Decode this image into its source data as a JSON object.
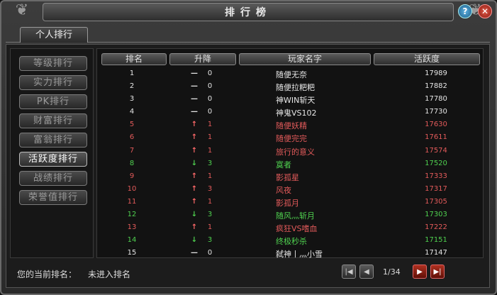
{
  "window": {
    "title": "排行榜"
  },
  "tabs": [
    {
      "label": "个人排行"
    }
  ],
  "sidebar": {
    "items": [
      {
        "label": "等级排行",
        "active": false
      },
      {
        "label": "实力排行",
        "active": false
      },
      {
        "label": "PK排行",
        "active": false
      },
      {
        "label": "财富排行",
        "active": false
      },
      {
        "label": "富翁排行",
        "active": false
      },
      {
        "label": "活跃度排行",
        "active": true
      },
      {
        "label": "战绩排行",
        "active": false
      },
      {
        "label": "荣誉值排行",
        "active": false
      }
    ]
  },
  "table": {
    "headers": {
      "rank": "排名",
      "change": "升降",
      "player": "玩家名字",
      "score": "活跃度"
    },
    "rows": [
      {
        "rank": "1",
        "arrow": "—",
        "delta": "0",
        "name": "随便无奈",
        "score": "17989",
        "color": "white"
      },
      {
        "rank": "2",
        "arrow": "—",
        "delta": "0",
        "name": "随便拉粑粑",
        "score": "17882",
        "color": "white"
      },
      {
        "rank": "3",
        "arrow": "—",
        "delta": "0",
        "name": "神WIN斩天",
        "score": "17780",
        "color": "white"
      },
      {
        "rank": "4",
        "arrow": "—",
        "delta": "0",
        "name": "神鬼VS102",
        "score": "17730",
        "color": "white"
      },
      {
        "rank": "5",
        "arrow": "↑",
        "delta": "1",
        "name": "随便妖精",
        "score": "17630",
        "color": "red"
      },
      {
        "rank": "6",
        "arrow": "↑",
        "delta": "1",
        "name": "随便完完",
        "score": "17611",
        "color": "red"
      },
      {
        "rank": "7",
        "arrow": "↑",
        "delta": "1",
        "name": "旅行的意义",
        "score": "17574",
        "color": "red"
      },
      {
        "rank": "8",
        "arrow": "↓",
        "delta": "3",
        "name": "寞者",
        "score": "17520",
        "color": "green"
      },
      {
        "rank": "9",
        "arrow": "↑",
        "delta": "1",
        "name": "影孤星",
        "score": "17333",
        "color": "red"
      },
      {
        "rank": "10",
        "arrow": "↑",
        "delta": "3",
        "name": "风夜",
        "score": "17317",
        "color": "red"
      },
      {
        "rank": "11",
        "arrow": "↑",
        "delta": "1",
        "name": "影孤月",
        "score": "17305",
        "color": "red"
      },
      {
        "rank": "12",
        "arrow": "↓",
        "delta": "3",
        "name": "随风灬斩月",
        "score": "17303",
        "color": "green"
      },
      {
        "rank": "13",
        "arrow": "↑",
        "delta": "1",
        "name": "疯狂VS嗜血",
        "score": "17222",
        "color": "red"
      },
      {
        "rank": "14",
        "arrow": "↓",
        "delta": "3",
        "name": "终极秒杀",
        "score": "17151",
        "color": "green"
      },
      {
        "rank": "15",
        "arrow": "—",
        "delta": "0",
        "name": "弑神丨灬小雪",
        "score": "17147",
        "color": "white"
      }
    ]
  },
  "footer": {
    "current_rank_label": "您的当前排名：",
    "current_rank_value": "未进入排名",
    "page": "1/34"
  },
  "icons": {
    "help": "question-icon",
    "close": "close-icon",
    "first": "first-page-icon",
    "prev": "prev-page-icon",
    "next": "next-page-icon",
    "last": "last-page-icon"
  }
}
